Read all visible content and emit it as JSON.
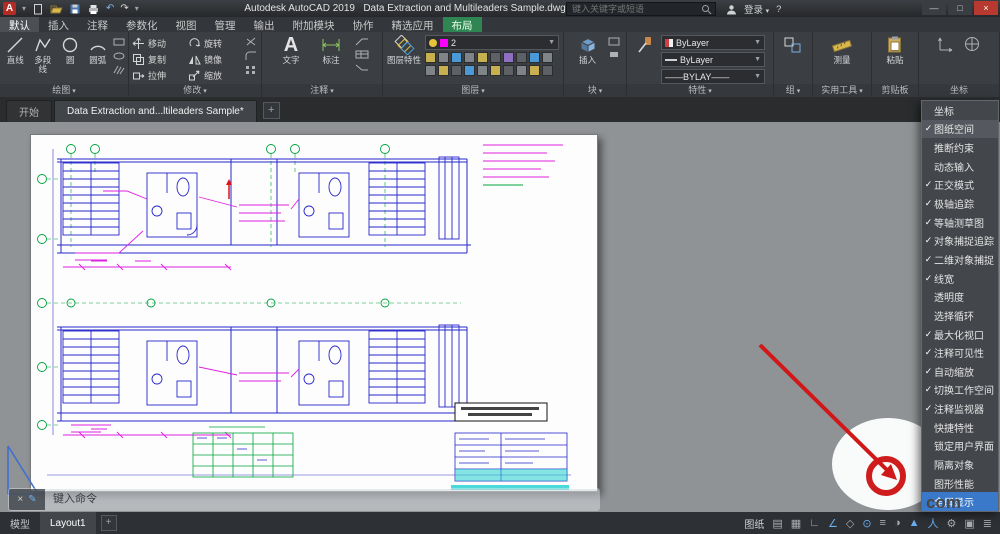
{
  "title_bar": {
    "app_title": "Autodesk AutoCAD 2019",
    "doc_title": "Data Extraction and Multileaders Sample.dwg",
    "search_placeholder": "键入关键字或短语",
    "signin_label": "登录",
    "help_glyph": "?",
    "window": {
      "min": "—",
      "max": "□",
      "close": "×"
    }
  },
  "ribbon": {
    "tabs": [
      "默认",
      "插入",
      "注释",
      "参数化",
      "视图",
      "管理",
      "输出",
      "附加模块",
      "协作",
      "精选应用",
      "布局"
    ],
    "panels": {
      "draw": {
        "label": "绘图",
        "tools": [
          "直线",
          "多段线",
          "圆",
          "圆弧"
        ]
      },
      "modify": {
        "label": "修改",
        "tools": [
          "移动",
          "旋转",
          "复制",
          "镜像",
          "拉伸",
          "缩放"
        ]
      },
      "annotate": {
        "label": "注释",
        "tools": [
          "文字",
          "标注"
        ]
      },
      "layers": {
        "label": "图层",
        "button": "图层特性",
        "current_layer": "2",
        "layer_color": "#ff00ff"
      },
      "blocks": {
        "label": "块",
        "tools": [
          "插入"
        ]
      },
      "properties": {
        "label": "特性",
        "dropdowns": [
          "ByLayer",
          "ByLayer",
          "——BYLAY——"
        ]
      },
      "groups": {
        "label": "组"
      },
      "utilities": {
        "label": "实用工具",
        "tools": [
          "测量"
        ]
      },
      "clipboard": {
        "label": "剪贴板",
        "tools": [
          "粘贴"
        ]
      },
      "coords": {
        "label": "坐标"
      }
    }
  },
  "icons": {
    "text_tool": "A"
  },
  "file_tabs": {
    "start": "开始",
    "document": "Data Extraction and...ltileaders Sample*",
    "new_tab": "+"
  },
  "status_menu": {
    "items": [
      {
        "label": "坐标",
        "check": ""
      },
      {
        "label": "图纸空间",
        "check": "✓"
      },
      {
        "label": "推断约束",
        "check": ""
      },
      {
        "label": "动态输入",
        "check": ""
      },
      {
        "label": "正交模式",
        "check": "✓"
      },
      {
        "label": "极轴追踪",
        "check": "✓"
      },
      {
        "label": "等轴测草图",
        "check": "✓"
      },
      {
        "label": "对象捕捉追踪",
        "check": "✓"
      },
      {
        "label": "二维对象捕捉",
        "check": "✓"
      },
      {
        "label": "线宽",
        "check": "✓"
      },
      {
        "label": "透明度",
        "check": ""
      },
      {
        "label": "选择循环",
        "check": ""
      },
      {
        "label": "最大化视口",
        "check": "✓"
      },
      {
        "label": "注释可见性",
        "check": "✓"
      },
      {
        "label": "自动缩放",
        "check": "✓"
      },
      {
        "label": "切换工作空间",
        "check": "✓"
      },
      {
        "label": "注释监视器",
        "check": "✓"
      },
      {
        "label": "快捷特性",
        "check": ""
      },
      {
        "label": "锁定用户界面",
        "check": ""
      },
      {
        "label": "隔离对象",
        "check": ""
      },
      {
        "label": "图形性能",
        "check": ""
      },
      {
        "label": "全屏显示",
        "check": ""
      }
    ]
  },
  "command_line": {
    "close_glyph": "×",
    "customize_glyph": "✎",
    "prompt": "键入命令"
  },
  "status_bar": {
    "model_tab": "模型",
    "layout_tab": "Layout1",
    "new_tab": "+",
    "paper_button": "图纸",
    "icons": [
      {
        "name": "snap-icon",
        "glyph": "▤"
      },
      {
        "name": "grid-icon",
        "glyph": "▦"
      },
      {
        "name": "ortho-icon",
        "glyph": "∟"
      },
      {
        "name": "polar-tracking-icon",
        "glyph": "∠"
      },
      {
        "name": "isodraft-icon",
        "glyph": "◇"
      },
      {
        "name": "object-snap-icon",
        "glyph": "⊙"
      },
      {
        "name": "lineweight-icon",
        "glyph": "≡"
      },
      {
        "name": "transparency-icon",
        "glyph": "◑"
      },
      {
        "name": "annotation-visibility-icon",
        "glyph": "▲"
      },
      {
        "name": "annotation-scale-icon",
        "glyph": "人"
      },
      {
        "name": "workspace-gear-icon",
        "glyph": "⚙"
      },
      {
        "name": "fullscreen-icon",
        "glyph": "▣"
      },
      {
        "name": "customize-icon",
        "glyph": "≣"
      }
    ]
  },
  "watermark": {
    "text": "com"
  },
  "colors": {
    "menu_highlight": "#3a78c9",
    "layout_tab_green": "#2f8653",
    "close_red": "#b8392f"
  }
}
